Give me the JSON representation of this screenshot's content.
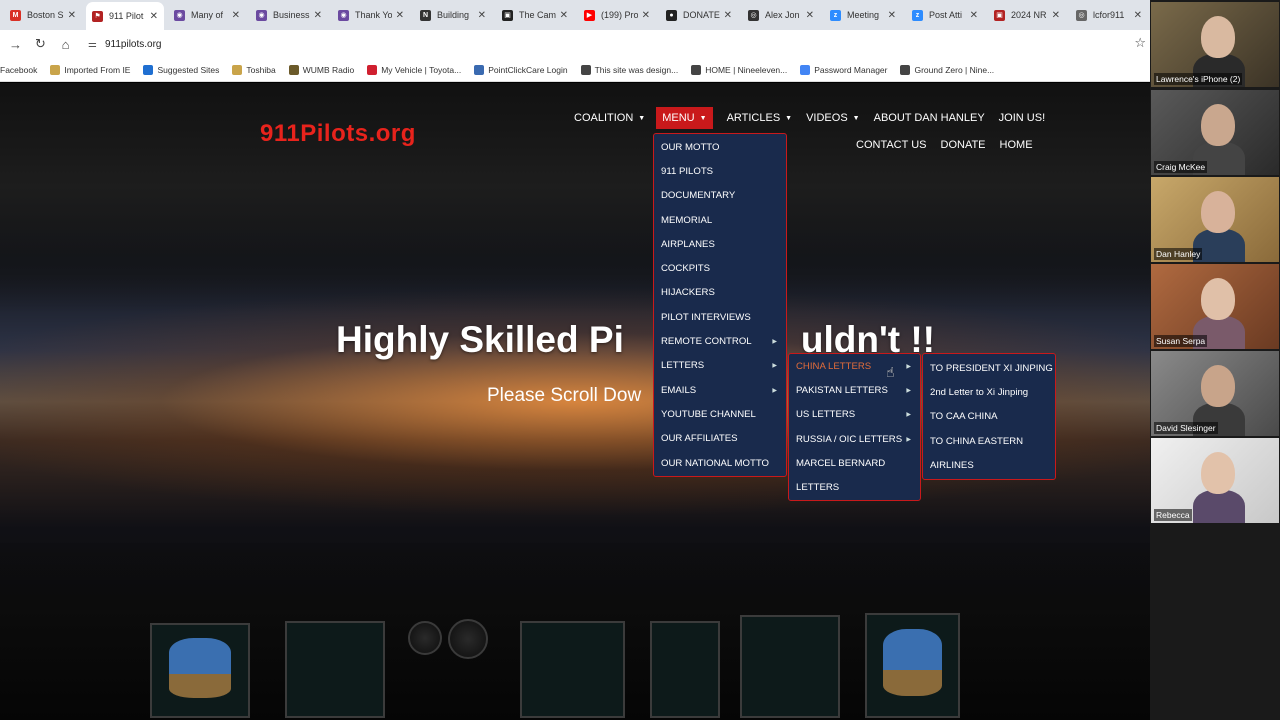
{
  "tabs": [
    {
      "title": "Boston S",
      "fav_color": "#d93025",
      "fav_glyph": "M"
    },
    {
      "title": "911 Pilot",
      "fav_color": "#b22222",
      "fav_glyph": "⚑",
      "active": true
    },
    {
      "title": "Many of",
      "fav_color": "#6b4aa0",
      "fav_glyph": "◉"
    },
    {
      "title": "Business",
      "fav_color": "#6b4aa0",
      "fav_glyph": "◉"
    },
    {
      "title": "Thank Yo",
      "fav_color": "#6b4aa0",
      "fav_glyph": "◉"
    },
    {
      "title": "Building",
      "fav_color": "#333333",
      "fav_glyph": "N"
    },
    {
      "title": "The Cam",
      "fav_color": "#222222",
      "fav_glyph": "▣"
    },
    {
      "title": "(199) Pro",
      "fav_color": "#ff0000",
      "fav_glyph": "▶"
    },
    {
      "title": "DONATE",
      "fav_color": "#222222",
      "fav_glyph": "●"
    },
    {
      "title": "Alex Jon",
      "fav_color": "#333333",
      "fav_glyph": "◎"
    },
    {
      "title": "Meeting",
      "fav_color": "#2d8cff",
      "fav_glyph": "z"
    },
    {
      "title": "Post Atti",
      "fav_color": "#2d8cff",
      "fav_glyph": "z"
    },
    {
      "title": "2024 NR",
      "fav_color": "#b22222",
      "fav_glyph": "▣"
    },
    {
      "title": "lcfor911",
      "fav_color": "#666666",
      "fav_glyph": "◎"
    }
  ],
  "url": "911pilots.org",
  "bookmarks": [
    {
      "label": "Facebook",
      "color": "transparent"
    },
    {
      "label": "Imported From IE",
      "color": "#c9a44a"
    },
    {
      "label": "Suggested Sites",
      "color": "#1f6fd1"
    },
    {
      "label": "Toshiba",
      "color": "#c9a44a"
    },
    {
      "label": "WUMB Radio",
      "color": "#6b5a2a"
    },
    {
      "label": "My Vehicle | Toyota...",
      "color": "#d02030"
    },
    {
      "label": "PointClickCare Login",
      "color": "#3a6ab0"
    },
    {
      "label": "This site was design...",
      "color": "#444444"
    },
    {
      "label": "HOME | Nineeleven...",
      "color": "#444444"
    },
    {
      "label": "Password Manager",
      "color": "#4285f4"
    },
    {
      "label": "Ground Zero | Nine...",
      "color": "#444444"
    }
  ],
  "site": {
    "logo": "911Pilots.org",
    "nav": [
      {
        "label": "COALITION",
        "caret": true
      },
      {
        "label": "MENU",
        "caret": true,
        "active": true
      },
      {
        "label": "ARTICLES",
        "caret": true
      },
      {
        "label": "VIDEOS",
        "caret": true
      },
      {
        "label": "ABOUT DAN HANLEY",
        "caret": false
      },
      {
        "label": "JOIN US!",
        "caret": false
      }
    ],
    "subnav": [
      "CONTACT US",
      "DONATE",
      "HOME"
    ],
    "hero_title": "Highly Skilled Pi",
    "hero_title_right": "uldn't !!",
    "hero_sub": "Please Scroll Dow",
    "menu_items": [
      {
        "label": "OUR MOTTO"
      },
      {
        "label": "911 PILOTS"
      },
      {
        "label": "DOCUMENTARY"
      },
      {
        "label": "MEMORIAL"
      },
      {
        "label": "AIRPLANES"
      },
      {
        "label": "COCKPITS"
      },
      {
        "label": "HIJACKERS"
      },
      {
        "label": "PILOT INTERVIEWS"
      },
      {
        "label": "REMOTE CONTROL",
        "sub": true
      },
      {
        "label": "LETTERS",
        "sub": true
      },
      {
        "label": "EMAILS",
        "sub": true
      },
      {
        "label": "YOUTUBE CHANNEL"
      },
      {
        "label": "OUR AFFILIATES"
      },
      {
        "label": "OUR NATIONAL MOTTO"
      }
    ],
    "letters_items": [
      {
        "label": "CHINA LETTERS",
        "sub": true,
        "highlight": true
      },
      {
        "label": "PAKISTAN LETTERS",
        "sub": true
      },
      {
        "label": "US LETTERS",
        "sub": true
      },
      {
        "label": "RUSSIA / OIC LETTERS",
        "sub": true
      },
      {
        "label": "MARCEL BERNARD"
      },
      {
        "label": "LETTERS"
      }
    ],
    "china_items": [
      {
        "label": "TO PRESIDENT XI JINPING"
      },
      {
        "label": "2nd Letter to Xi Jinping"
      },
      {
        "label": "TO CAA CHINA"
      },
      {
        "label": "TO CHINA EASTERN"
      },
      {
        "label": "AIRLINES"
      }
    ]
  },
  "participants": [
    {
      "name": "Lawrence's iPhone (2)"
    },
    {
      "name": "Craig McKee"
    },
    {
      "name": "Dan Hanley"
    },
    {
      "name": "Susan Serpa"
    },
    {
      "name": "David Slesinger"
    },
    {
      "name": "Rebecca"
    }
  ],
  "colors": {
    "accent_red": "#c9191b",
    "dropdown_bg": "#192a4c",
    "logo_red": "#e8231c",
    "highlight": "#e26c3a"
  }
}
